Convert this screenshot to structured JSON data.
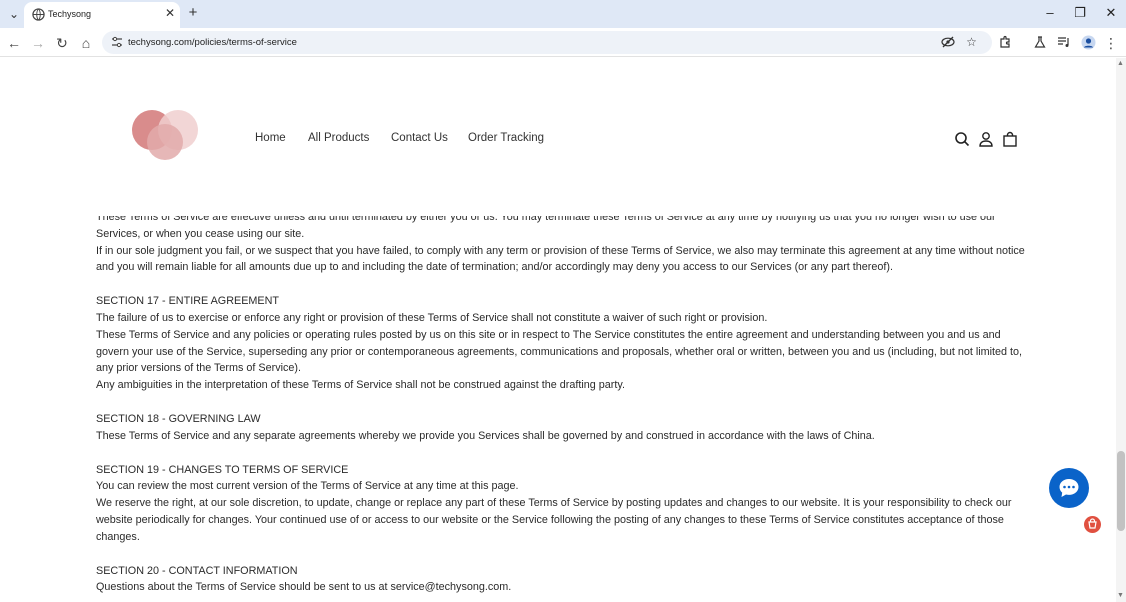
{
  "browser": {
    "tab_title": "Techysong",
    "url": "techysong.com/policies/terms-of-service",
    "icons": [
      "tab-search-dropdown-icon",
      "globe-icon",
      "close-icon",
      "plus-icon",
      "minimize-icon",
      "restore-icon",
      "window-close-icon",
      "back-icon",
      "forward-icon",
      "reload-icon",
      "home-icon",
      "site-settings-icon",
      "eye-off-icon",
      "star-icon",
      "extensions-icon",
      "lab-icon",
      "media-icon",
      "profile-icon",
      "menu-icon"
    ]
  },
  "site": {
    "nav": [
      "Home",
      "All Products",
      "Contact Us",
      "Order Tracking"
    ],
    "header_icons": [
      "search-icon",
      "account-icon",
      "cart-icon"
    ],
    "accent_colors": {
      "logo": "#d98c8c",
      "chat": "#0a63c9"
    }
  },
  "content": {
    "partial_line": "These Terms of Service are effective unless and until terminated by either you or us. You may terminate these Terms of Service at any time by notifying us that you no longer wish to use our",
    "p1_end": "Services, or when you cease using our site.",
    "p2": "If in our sole judgment you fail, or we suspect that you have failed, to comply with any term or provision of these Terms of Service, we also may terminate this agreement at any time without notice and you will remain liable for all amounts due up to and including the date of termination; and/or accordingly may deny you access to our Services (or any part thereof).",
    "s17_head": "SECTION 17 - ENTIRE AGREEMENT",
    "s17_p1": "The failure of us to exercise or enforce any right or provision of these Terms of Service shall not constitute a waiver of such right or provision.",
    "s17_p2": "These Terms of Service and any policies or operating rules posted by us on this site or in respect to The Service constitutes the entire agreement and understanding between you and us and govern your use of the Service, superseding any prior or contemporaneous agreements, communications and proposals, whether oral or written, between you and us (including, but not limited to, any prior versions of the Terms of Service).",
    "s17_p3": "Any ambiguities in the interpretation of these Terms of Service shall not be construed against the drafting party.",
    "s18_head": "SECTION 18 - GOVERNING LAW",
    "s18_p1": "These Terms of Service and any separate agreements whereby we provide you Services shall be governed by and construed in accordance with the laws of China.",
    "s19_head": "SECTION 19 - CHANGES TO TERMS OF SERVICE",
    "s19_p1": "You can review the most current version of the Terms of Service at any time at this page.",
    "s19_p2": "We reserve the right, at our sole discretion, to update, change or replace any part of these Terms of Service by posting updates and changes to our website. It is your responsibility to check our website periodically for changes. Your continued use of or access to our website or the Service following the posting of any changes to these Terms of Service constitutes acceptance of those changes.",
    "s20_head": "SECTION 20 - CONTACT INFORMATION",
    "s20_p1": "Questions about the Terms of Service should be sent to us at service@techysong.com."
  }
}
